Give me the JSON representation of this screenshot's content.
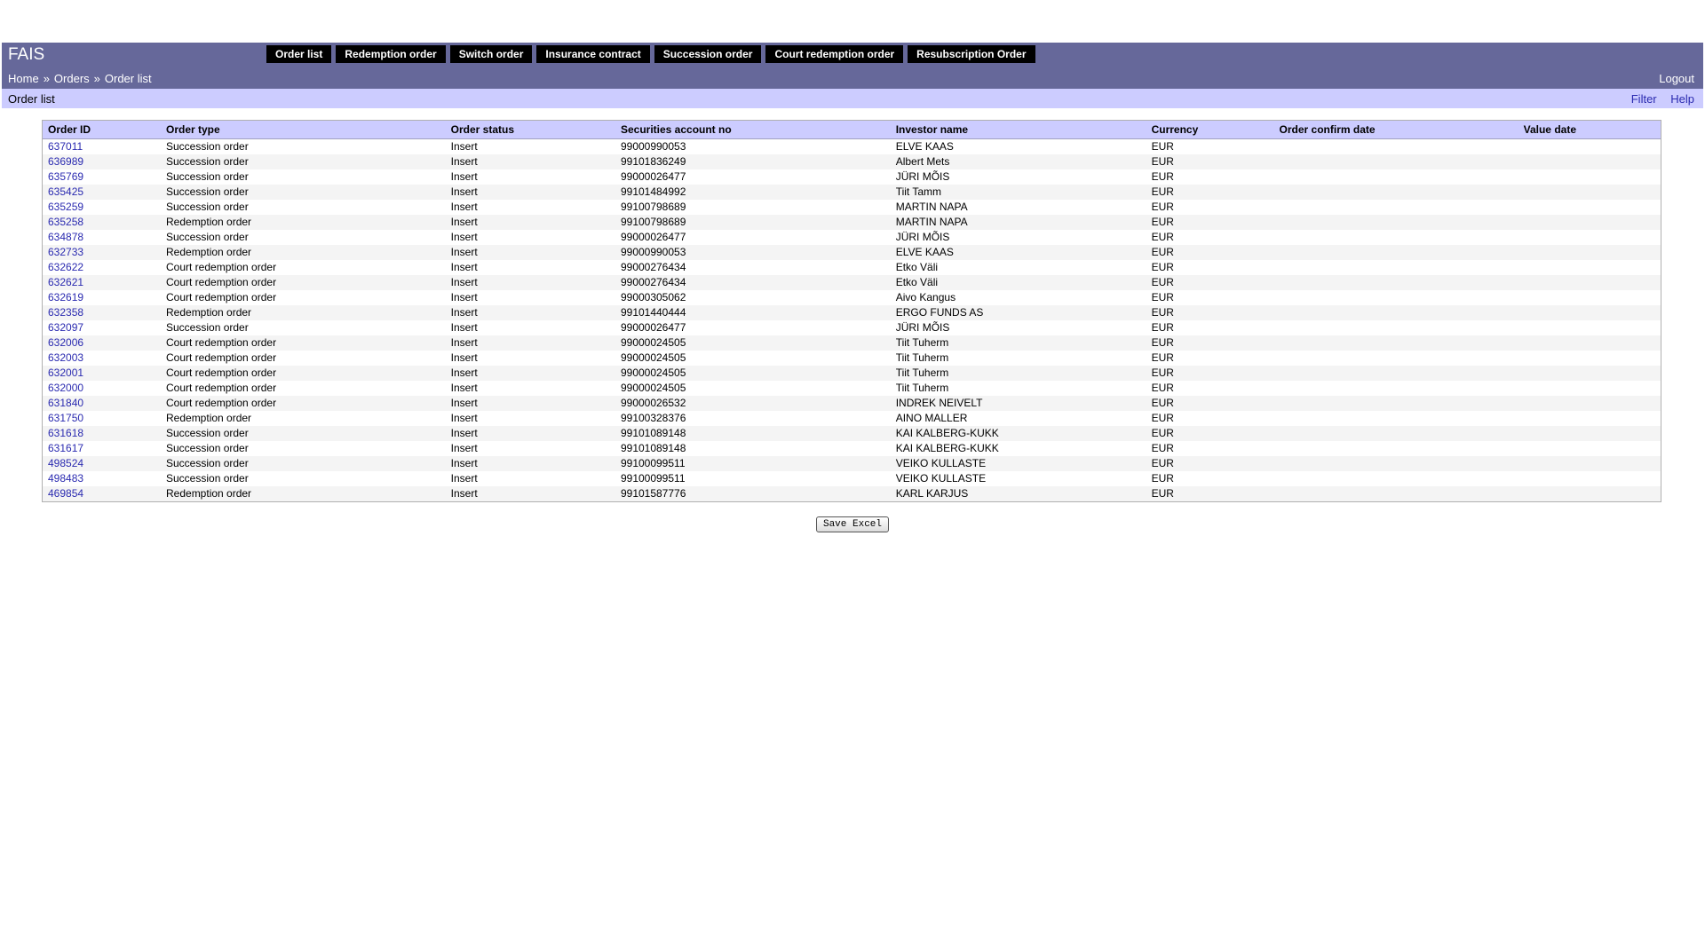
{
  "app": {
    "title": "FAIS"
  },
  "nav": [
    {
      "label": "Order list"
    },
    {
      "label": "Redemption order"
    },
    {
      "label": "Switch order"
    },
    {
      "label": "Insurance contract"
    },
    {
      "label": "Succession order"
    },
    {
      "label": "Court redemption order"
    },
    {
      "label": "Resubscription Order"
    }
  ],
  "breadcrumb": [
    {
      "label": "Home"
    },
    {
      "label": "Orders"
    },
    {
      "label": "Order list"
    }
  ],
  "breadcrumb_sep": "»",
  "logout_label": "Logout",
  "page": {
    "title": "Order list",
    "filter_label": "Filter",
    "help_label": "Help"
  },
  "table": {
    "headers": [
      "Order ID",
      "Order type",
      "Order status",
      "Securities account no",
      "Investor name",
      "Currency",
      "Order confirm date",
      "Value date"
    ],
    "rows": [
      [
        "637011",
        "Succession order",
        "Insert",
        "99000990053",
        "ELVE KAAS",
        "EUR",
        "",
        ""
      ],
      [
        "636989",
        "Succession order",
        "Insert",
        "99101836249",
        "Albert Mets",
        "EUR",
        "",
        ""
      ],
      [
        "635769",
        "Succession order",
        "Insert",
        "99000026477",
        "JÜRI MÕIS",
        "EUR",
        "",
        ""
      ],
      [
        "635425",
        "Succession order",
        "Insert",
        "99101484992",
        "Tiit Tamm",
        "EUR",
        "",
        ""
      ],
      [
        "635259",
        "Succession order",
        "Insert",
        "99100798689",
        "MARTIN NAPA",
        "EUR",
        "",
        ""
      ],
      [
        "635258",
        "Redemption order",
        "Insert",
        "99100798689",
        "MARTIN NAPA",
        "EUR",
        "",
        ""
      ],
      [
        "634878",
        "Succession order",
        "Insert",
        "99000026477",
        "JÜRI MÕIS",
        "EUR",
        "",
        ""
      ],
      [
        "632733",
        "Redemption order",
        "Insert",
        "99000990053",
        "ELVE KAAS",
        "EUR",
        "",
        ""
      ],
      [
        "632622",
        "Court redemption order",
        "Insert",
        "99000276434",
        "Etko Väli",
        "EUR",
        "",
        ""
      ],
      [
        "632621",
        "Court redemption order",
        "Insert",
        "99000276434",
        "Etko Väli",
        "EUR",
        "",
        ""
      ],
      [
        "632619",
        "Court redemption order",
        "Insert",
        "99000305062",
        "Aivo Kangus",
        "EUR",
        "",
        ""
      ],
      [
        "632358",
        "Redemption order",
        "Insert",
        "99101440444",
        "ERGO FUNDS AS",
        "EUR",
        "",
        ""
      ],
      [
        "632097",
        "Succession order",
        "Insert",
        "99000026477",
        "JÜRI MÕIS",
        "EUR",
        "",
        ""
      ],
      [
        "632006",
        "Court redemption order",
        "Insert",
        "99000024505",
        "Tiit Tuherm",
        "EUR",
        "",
        ""
      ],
      [
        "632003",
        "Court redemption order",
        "Insert",
        "99000024505",
        "Tiit Tuherm",
        "EUR",
        "",
        ""
      ],
      [
        "632001",
        "Court redemption order",
        "Insert",
        "99000024505",
        "Tiit Tuherm",
        "EUR",
        "",
        ""
      ],
      [
        "632000",
        "Court redemption order",
        "Insert",
        "99000024505",
        "Tiit Tuherm",
        "EUR",
        "",
        ""
      ],
      [
        "631840",
        "Court redemption order",
        "Insert",
        "99000026532",
        "INDREK NEIVELT",
        "EUR",
        "",
        ""
      ],
      [
        "631750",
        "Redemption order",
        "Insert",
        "99100328376",
        "AINO MALLER",
        "EUR",
        "",
        ""
      ],
      [
        "631618",
        "Succession order",
        "Insert",
        "99101089148",
        "KAI KALBERG-KUKK",
        "EUR",
        "",
        ""
      ],
      [
        "631617",
        "Succession order",
        "Insert",
        "99101089148",
        "KAI KALBERG-KUKK",
        "EUR",
        "",
        ""
      ],
      [
        "498524",
        "Succession order",
        "Insert",
        "99100099511",
        "VEIKO KULLASTE",
        "EUR",
        "",
        ""
      ],
      [
        "498483",
        "Succession order",
        "Insert",
        "99100099511",
        "VEIKO KULLASTE",
        "EUR",
        "",
        ""
      ],
      [
        "469854",
        "Redemption order",
        "Insert",
        "99101587776",
        "KARL KARJUS",
        "EUR",
        "",
        ""
      ]
    ]
  },
  "save_excel_label": "Save Excel",
  "colors": {
    "header_bg": "#66689a",
    "subbar_bg": "#ccccff",
    "link": "#2a2ab0",
    "nav_bg": "#000000"
  }
}
